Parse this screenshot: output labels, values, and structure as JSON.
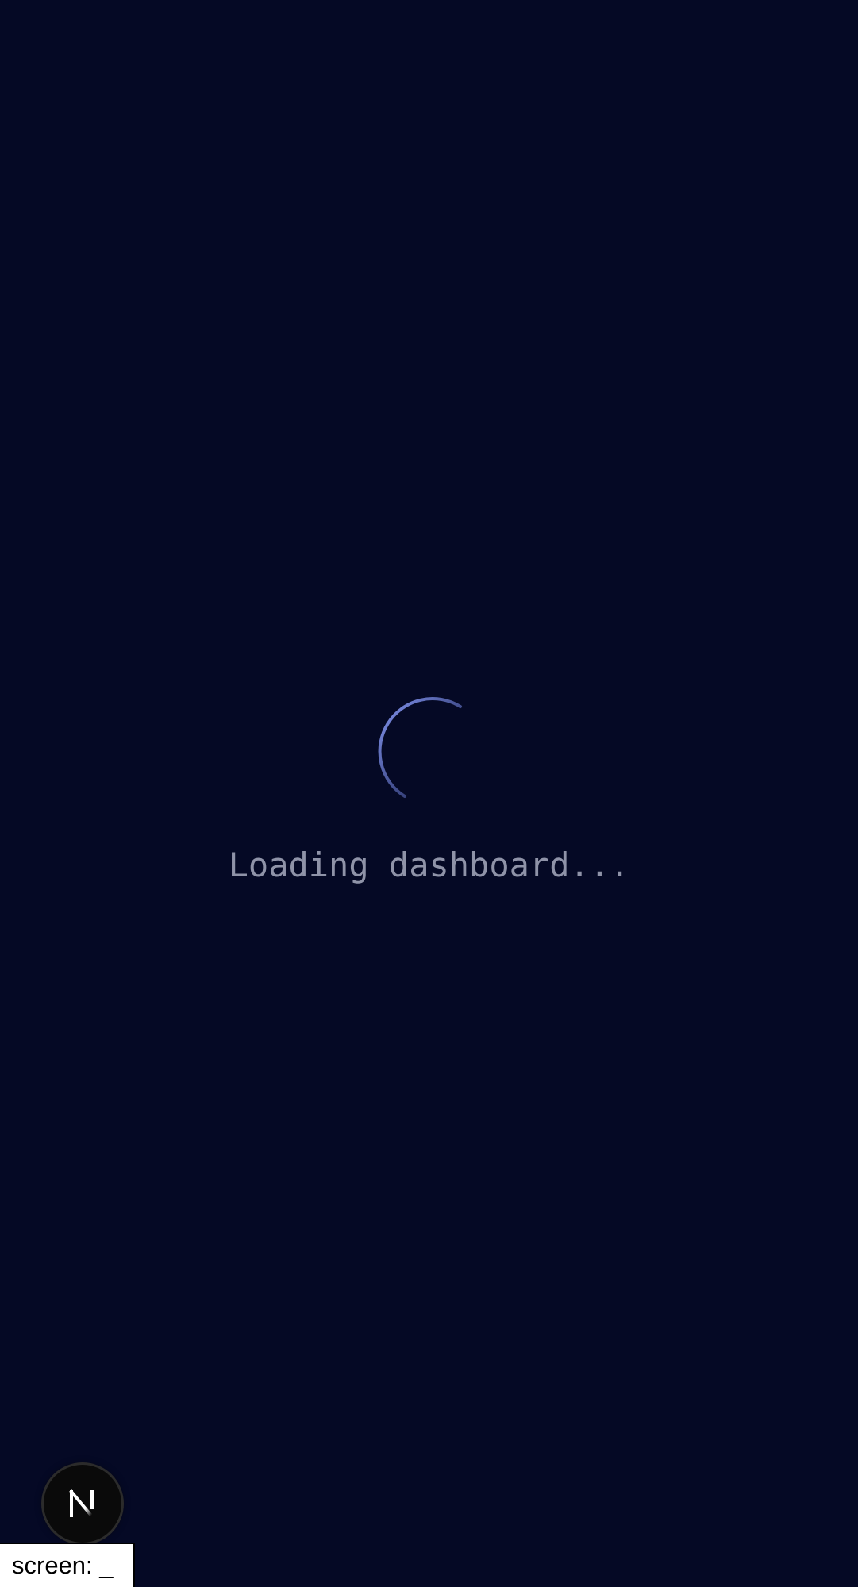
{
  "loading": {
    "message": "Loading dashboard..."
  },
  "devtools": {
    "badge_letter": "N",
    "screen_label": "screen: _"
  },
  "icons": {
    "spinner": "loading-spinner-icon",
    "next_logo": "nextjs-logo-icon"
  },
  "colors": {
    "background": "#050925",
    "spinner_accent": "#7b8ee8",
    "loading_text": "#8f93a8",
    "badge_background": "#0a0a0a",
    "indicator_background": "#ffffff"
  }
}
